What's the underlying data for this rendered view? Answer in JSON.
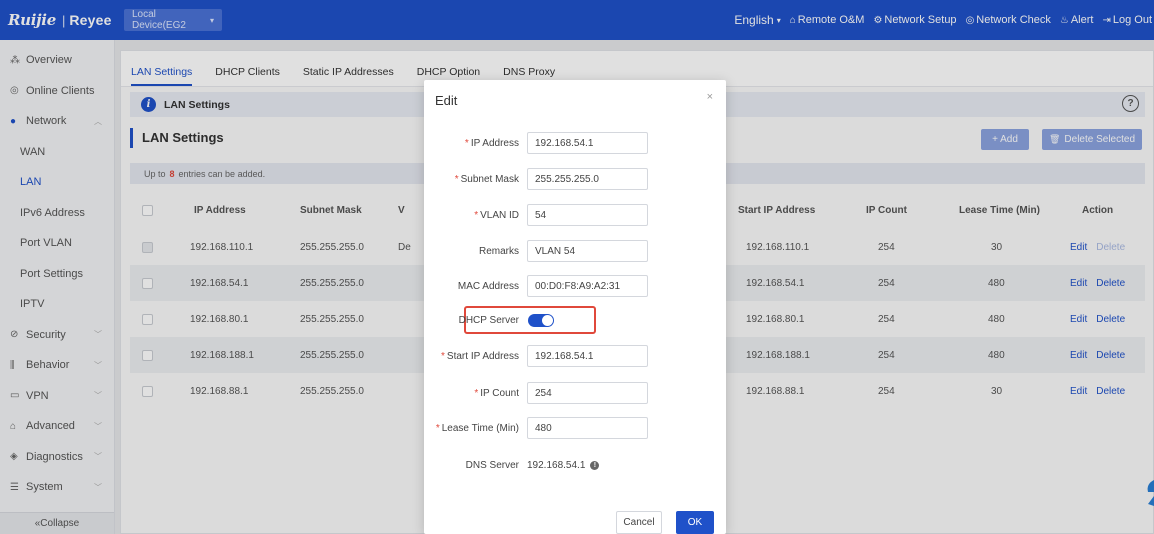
{
  "topbar": {
    "brand": "Ruijie",
    "brand2": "Reyee",
    "device": "Local Device(EG2",
    "language": "English",
    "links": [
      {
        "icon": "remote-icon",
        "label": "Remote O&M"
      },
      {
        "icon": "network-setup-icon",
        "label": "Network Setup"
      },
      {
        "icon": "network-check-icon",
        "label": "Network Check"
      },
      {
        "icon": "alert-icon",
        "label": "Alert"
      },
      {
        "icon": "logout-icon",
        "label": "Log Out"
      }
    ]
  },
  "sidebar": {
    "items": [
      {
        "label": "Overview"
      },
      {
        "label": "Online Clients"
      },
      {
        "label": "Network"
      },
      {
        "label": "WAN"
      },
      {
        "label": "LAN"
      },
      {
        "label": "IPv6 Address"
      },
      {
        "label": "Port VLAN"
      },
      {
        "label": "Port Settings"
      },
      {
        "label": "IPTV"
      },
      {
        "label": "Security"
      },
      {
        "label": "Behavior"
      },
      {
        "label": "VPN"
      },
      {
        "label": "Advanced"
      },
      {
        "label": "Diagnostics"
      },
      {
        "label": "System"
      }
    ],
    "collapse": "«Collapse"
  },
  "tabs": [
    "LAN Settings",
    "DHCP Clients",
    "Static IP Addresses",
    "DHCP Option",
    "DNS Proxy"
  ],
  "info_bar": {
    "title": "LAN Settings"
  },
  "section": {
    "title": "LAN Settings",
    "add_label": "+ Add",
    "delete_selected_label": "Delete Selected"
  },
  "limit": {
    "prefix": "Up to",
    "count": "8",
    "suffix": "entries can be added."
  },
  "table": {
    "headers": {
      "ip": "IP Address",
      "mask": "Subnet Mask",
      "vlan": "V",
      "start": "Start IP Address",
      "count": "IP Count",
      "lease": "Lease Time (Min)",
      "action": "Action"
    },
    "rows": [
      {
        "ip": "192.168.110.1",
        "mask": "255.255.255.0",
        "vlan": "De",
        "start": "192.168.110.1",
        "count": "254",
        "lease": "30",
        "edit": "Edit",
        "delete": "Delete",
        "delete_disabled": true
      },
      {
        "ip": "192.168.54.1",
        "mask": "255.255.255.0",
        "vlan": "",
        "start": "192.168.54.1",
        "count": "254",
        "lease": "480",
        "edit": "Edit",
        "delete": "Delete",
        "delete_disabled": false
      },
      {
        "ip": "192.168.80.1",
        "mask": "255.255.255.0",
        "vlan": "",
        "start": "192.168.80.1",
        "count": "254",
        "lease": "480",
        "edit": "Edit",
        "delete": "Delete",
        "delete_disabled": false
      },
      {
        "ip": "192.168.188.1",
        "mask": "255.255.255.0",
        "vlan": "",
        "start": "192.168.188.1",
        "count": "254",
        "lease": "480",
        "edit": "Edit",
        "delete": "Delete",
        "delete_disabled": false
      },
      {
        "ip": "192.168.88.1",
        "mask": "255.255.255.0",
        "vlan": "",
        "start": "192.168.88.1",
        "count": "254",
        "lease": "30",
        "edit": "Edit",
        "delete": "Delete",
        "delete_disabled": false
      }
    ]
  },
  "modal": {
    "title": "Edit",
    "close": "×",
    "fields": {
      "ip": {
        "label": "IP Address",
        "value": "192.168.54.1"
      },
      "mask": {
        "label": "Subnet Mask",
        "value": "255.255.255.0"
      },
      "vlan": {
        "label": "VLAN ID",
        "value": "54"
      },
      "remarks": {
        "label": "Remarks",
        "value": "VLAN 54"
      },
      "mac": {
        "label": "MAC Address",
        "value": "00:D0:F8:A9:A2:31"
      },
      "dhcp": {
        "label": "DHCP Server",
        "enabled": true
      },
      "start_ip": {
        "label": "Start IP Address",
        "value": "192.168.54.1"
      },
      "ip_count": {
        "label": "IP Count",
        "value": "254"
      },
      "lease": {
        "label": "Lease Time (Min)",
        "value": "480"
      },
      "dns": {
        "label": "DNS Server",
        "value": "192.168.54.1"
      }
    },
    "cancel_label": "Cancel",
    "ok_label": "OK"
  },
  "colors": {
    "primary": "#1f51c9",
    "highlight": "#e0483b"
  }
}
